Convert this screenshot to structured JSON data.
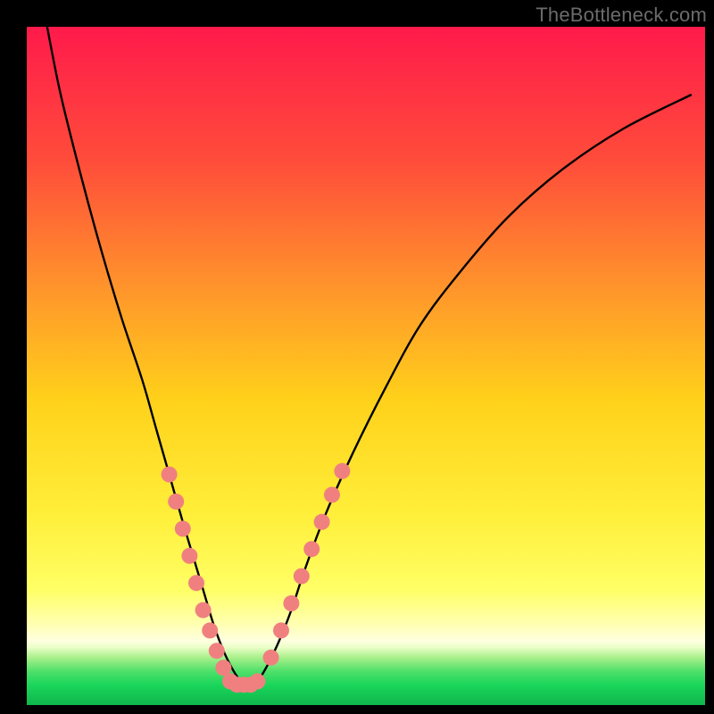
{
  "watermark": "TheBottleneck.com",
  "chart_data": {
    "type": "line",
    "title": "",
    "xlabel": "",
    "ylabel": "",
    "xlim": [
      0,
      100
    ],
    "ylim": [
      0,
      100
    ],
    "grid": false,
    "legend": false,
    "annotations": [],
    "background_gradient_stops": [
      {
        "offset": 0.0,
        "color": "#ff1a4b"
      },
      {
        "offset": 0.2,
        "color": "#ff4d3a"
      },
      {
        "offset": 0.4,
        "color": "#ff9a2a"
      },
      {
        "offset": 0.55,
        "color": "#ffd11a"
      },
      {
        "offset": 0.72,
        "color": "#ffef3a"
      },
      {
        "offset": 0.83,
        "color": "#ffff66"
      },
      {
        "offset": 0.88,
        "color": "#ffffb0"
      },
      {
        "offset": 0.905,
        "color": "#ffffe0"
      },
      {
        "offset": 0.915,
        "color": "#eaffc8"
      },
      {
        "offset": 0.93,
        "color": "#a8f08a"
      },
      {
        "offset": 0.95,
        "color": "#4fe06a"
      },
      {
        "offset": 0.97,
        "color": "#1ad65a"
      },
      {
        "offset": 1.0,
        "color": "#0fb64c"
      }
    ],
    "series": [
      {
        "name": "bottleneck-curve",
        "color": "#000000",
        "x": [
          3,
          5,
          8,
          11,
          14,
          17,
          19,
          21,
          23,
          24.5,
          26,
          27.5,
          29,
          30.5,
          32,
          33.5,
          35,
          37,
          39,
          41,
          44,
          48,
          53,
          58,
          64,
          71,
          79,
          88,
          98
        ],
        "y": [
          100,
          90,
          78,
          67,
          57,
          48,
          41,
          34,
          27,
          22,
          17,
          12,
          8,
          5,
          3,
          3,
          5,
          9,
          14,
          20,
          28,
          37,
          47,
          56,
          64,
          72,
          79,
          85,
          90
        ]
      }
    ],
    "markers": {
      "name": "highlight-dots",
      "color": "#f08080",
      "radius_px": 9,
      "points": [
        {
          "x": 21.0,
          "y": 34.0
        },
        {
          "x": 22.0,
          "y": 30.0
        },
        {
          "x": 23.0,
          "y": 26.0
        },
        {
          "x": 24.0,
          "y": 22.0
        },
        {
          "x": 25.0,
          "y": 18.0
        },
        {
          "x": 26.0,
          "y": 14.0
        },
        {
          "x": 27.0,
          "y": 11.0
        },
        {
          "x": 28.0,
          "y": 8.0
        },
        {
          "x": 29.0,
          "y": 5.5
        },
        {
          "x": 30.0,
          "y": 3.5
        },
        {
          "x": 31.0,
          "y": 3.0
        },
        {
          "x": 32.0,
          "y": 3.0
        },
        {
          "x": 33.0,
          "y": 3.0
        },
        {
          "x": 34.0,
          "y": 3.5
        },
        {
          "x": 36.0,
          "y": 7.0
        },
        {
          "x": 37.5,
          "y": 11.0
        },
        {
          "x": 39.0,
          "y": 15.0
        },
        {
          "x": 40.5,
          "y": 19.0
        },
        {
          "x": 42.0,
          "y": 23.0
        },
        {
          "x": 43.5,
          "y": 27.0
        },
        {
          "x": 45.0,
          "y": 31.0
        },
        {
          "x": 46.5,
          "y": 34.5
        }
      ]
    }
  }
}
